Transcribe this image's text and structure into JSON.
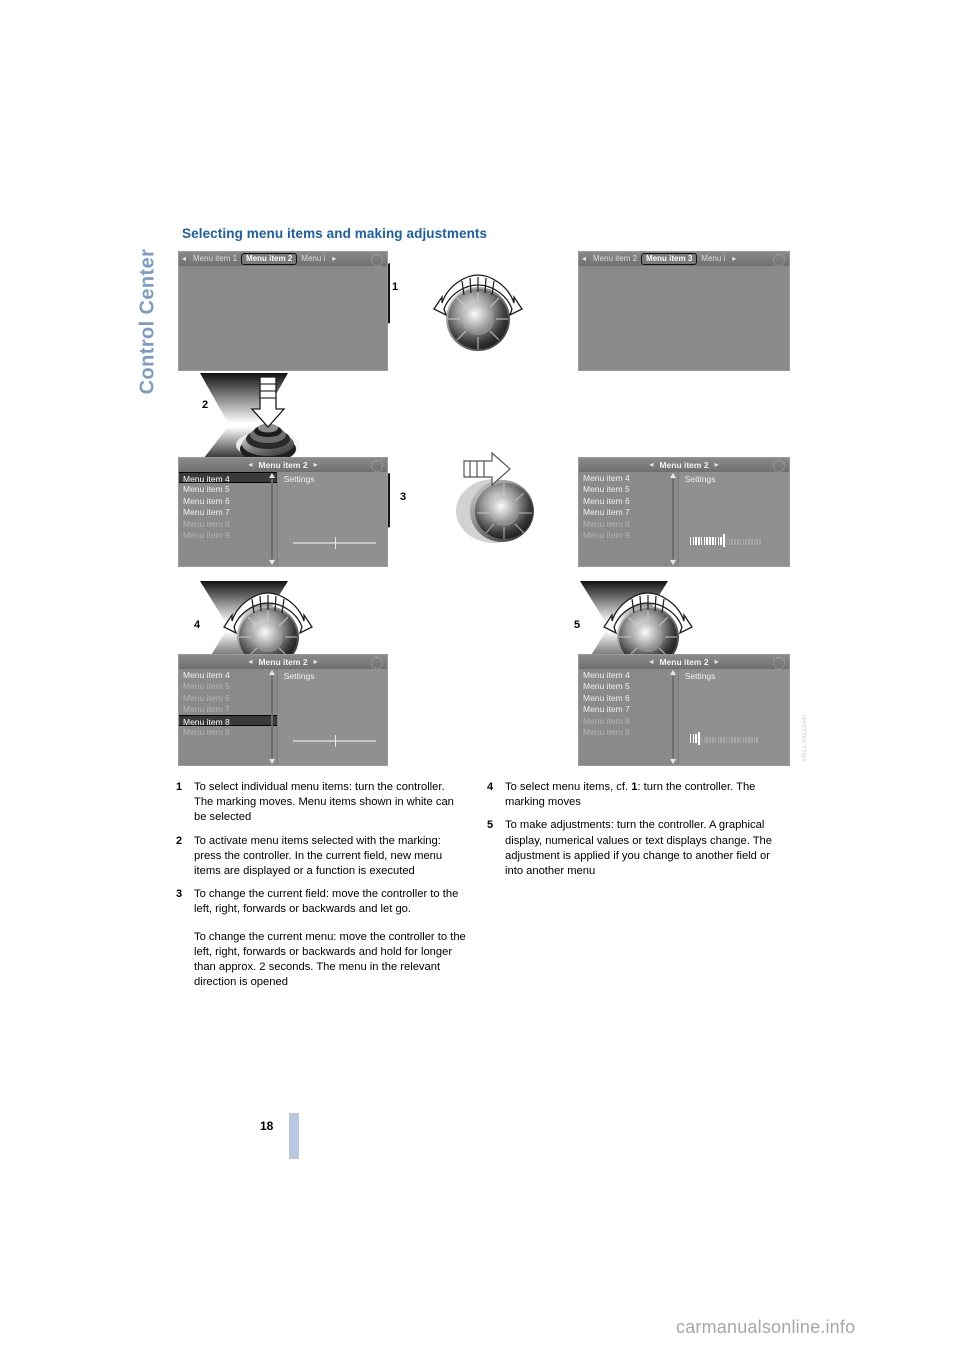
{
  "chapter_tab": {
    "label": "Control Center"
  },
  "heading": "Selecting menu items and making adjustments",
  "figure": {
    "code": "VN12.00232AVI",
    "step_numbers": [
      "1",
      "2",
      "3",
      "4",
      "5"
    ],
    "screens": [
      {
        "id": "top-left",
        "topbar": {
          "left_arrow": "◂",
          "right_arrow": "▸",
          "tabs": [
            "Menu item 1",
            "Menu item 2",
            "Menu i"
          ],
          "selected_tab": "Menu item 2",
          "gear_icon": "gear-icon"
        },
        "list": [],
        "settings_title": "",
        "indicator": "none"
      },
      {
        "id": "top-right",
        "topbar": {
          "left_arrow": "◂",
          "right_arrow": "▸",
          "tabs": [
            "Menu item 2",
            "Menu item 3",
            "Menu i"
          ],
          "selected_tab": "Menu item 3",
          "gear_icon": "gear-icon"
        },
        "list": [],
        "settings_title": "",
        "indicator": "none"
      },
      {
        "id": "mid-left",
        "topbar": {
          "left_arrow": "◂",
          "right_arrow": "▸",
          "title": "Menu item 2",
          "gear_icon": "gear-icon"
        },
        "list": [
          "Menu item 4",
          "Menu item 5",
          "Menu item 6",
          "Menu item 7",
          "Menu item 8",
          "Menu item 9"
        ],
        "marked_item": "Menu item 4",
        "settings_title": "Settings",
        "indicator": "slider"
      },
      {
        "id": "mid-right",
        "topbar": {
          "left_arrow": "◂",
          "right_arrow": "▸",
          "title": "Menu item 2",
          "gear_icon": "gear-icon"
        },
        "list": [
          "Menu item 4",
          "Menu item 5",
          "Menu item 6",
          "Menu item 7",
          "Menu item 8",
          "Menu item 9"
        ],
        "marked_item": "",
        "settings_title": "Settings",
        "indicator": "bargraph-high"
      },
      {
        "id": "bot-left",
        "topbar": {
          "left_arrow": "◂",
          "right_arrow": "▸",
          "title": "Menu item 2",
          "gear_icon": "gear-icon"
        },
        "list": [
          "Menu item 4",
          "Menu item 5",
          "Menu item 6",
          "Menu item 7",
          "Menu item 8",
          "Menu item 9"
        ],
        "marked_item": "Menu item 8",
        "settings_title": "Settings",
        "indicator": "slider"
      },
      {
        "id": "bot-right",
        "topbar": {
          "left_arrow": "◂",
          "right_arrow": "▸",
          "title": "Menu item 2",
          "gear_icon": "gear-icon"
        },
        "list": [
          "Menu item 4",
          "Menu item 5",
          "Menu item 6",
          "Menu item 7",
          "Menu item 8",
          "Menu item 9"
        ],
        "marked_item": "",
        "settings_title": "Settings",
        "indicator": "bargraph-low"
      }
    ]
  },
  "steps_left": [
    {
      "num": "1",
      "paragraphs": [
        "To select individual menu items: turn the controller. The marking moves. Menu items shown in white can be selected"
      ]
    },
    {
      "num": "2",
      "paragraphs": [
        "To activate menu items selected with the marking: press the controller. In the current field, new menu items are displayed or a function is executed"
      ]
    },
    {
      "num": "3",
      "paragraphs": [
        "To change the current field: move the controller to the left, right, forwards or backwards and let go.",
        "To change the current menu:  move the controller to the left, right, forwards or backwards and hold for longer than approx. 2 seconds. The menu in the relevant direction is opened"
      ]
    }
  ],
  "steps_right": [
    {
      "num": "4",
      "paragraphs": [
        "To select menu items, cf. 1: turn the controller. The marking moves"
      ]
    },
    {
      "num": "5",
      "paragraphs": [
        "To make adjustments: turn the controller. A graphical display, numerical values or text displays change. The adjustment is applied if you change to another field or into another menu"
      ]
    }
  ],
  "page_number": "18",
  "watermark": "carmanualsonline.info",
  "colors": {
    "heading_blue": "#1a5fa8",
    "tab_blue": "#7d9bc6",
    "page_bar_blue": "#b9c8e2",
    "screen_gray": "#8a8a8a"
  }
}
